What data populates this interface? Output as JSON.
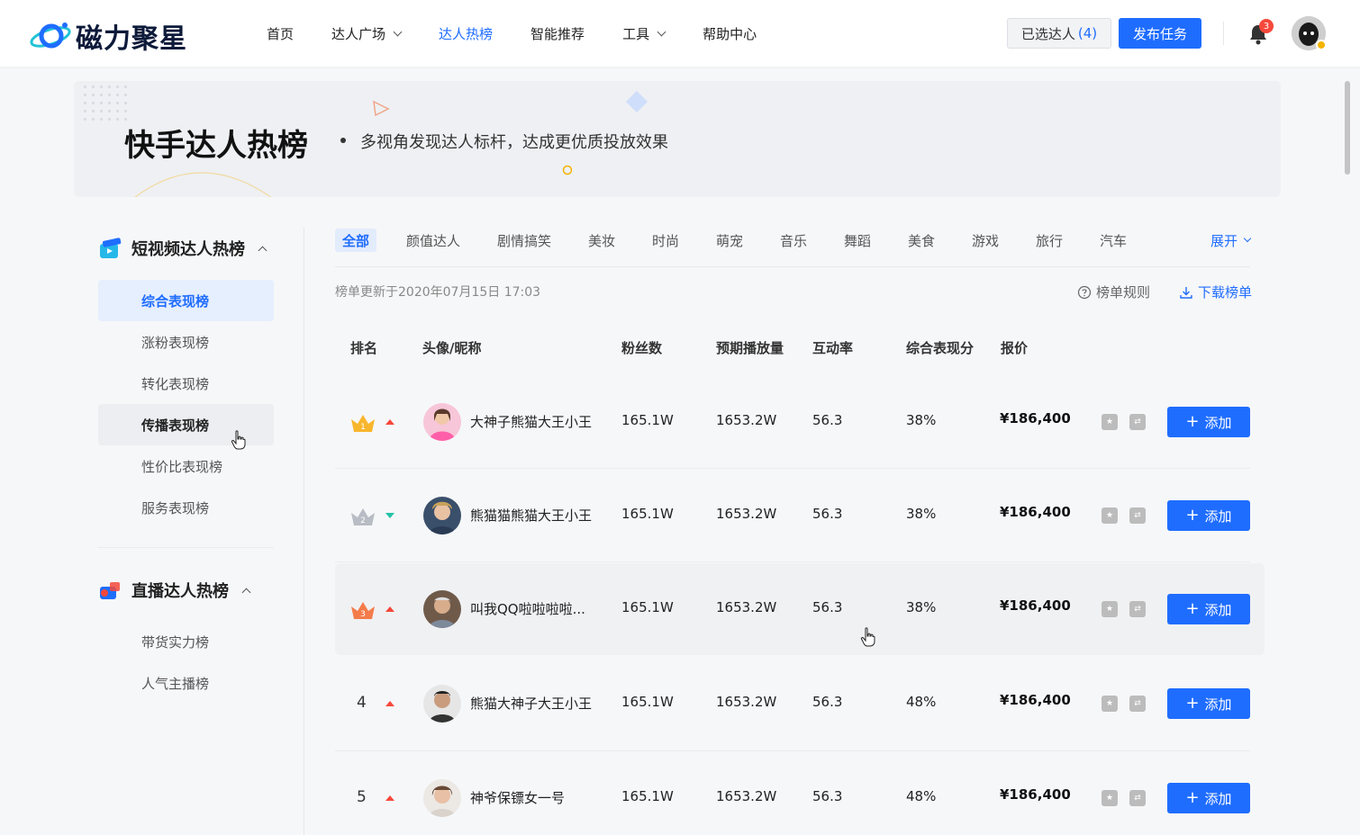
{
  "app": {
    "logo_text": "磁力聚星",
    "colors": {
      "brand": "#1f6dff",
      "accent_red": "#f5483b",
      "accent_teal": "#23c2a5",
      "highlight_bg": "#e6effd"
    }
  },
  "nav": {
    "items": [
      {
        "label": "首页",
        "active": false,
        "dropdown": false
      },
      {
        "label": "达人广场",
        "active": false,
        "dropdown": true
      },
      {
        "label": "达人热榜",
        "active": true,
        "dropdown": false
      },
      {
        "label": "智能推荐",
        "active": false,
        "dropdown": false
      },
      {
        "label": "工具",
        "active": false,
        "dropdown": true
      },
      {
        "label": "帮助中心",
        "active": false,
        "dropdown": false
      }
    ],
    "selected_label": "已选达人",
    "selected_count": "(4)",
    "publish_label": "发布任务",
    "notification_count": "3"
  },
  "banner": {
    "title": "快手达人热榜",
    "subtitle": "多视角发现达人标杆，达成更优质投放效果"
  },
  "sidebar": {
    "group1": {
      "label": "短视频达人热榜",
      "items": [
        {
          "label": "综合表现榜",
          "state": "active"
        },
        {
          "label": "涨粉表现榜",
          "state": ""
        },
        {
          "label": "转化表现榜",
          "state": ""
        },
        {
          "label": "传播表现榜",
          "state": "hover"
        },
        {
          "label": "性价比表现榜",
          "state": ""
        },
        {
          "label": "服务表现榜",
          "state": ""
        }
      ]
    },
    "group2": {
      "label": "直播达人热榜",
      "items": [
        {
          "label": "带货实力榜",
          "state": ""
        },
        {
          "label": "人气主播榜",
          "state": ""
        }
      ]
    }
  },
  "tabs": {
    "items": [
      "全部",
      "颜值达人",
      "剧情搞笑",
      "美妆",
      "时尚",
      "萌宠",
      "音乐",
      "舞蹈",
      "美食",
      "游戏",
      "旅行",
      "汽车"
    ],
    "active_index": 0,
    "expand_label": "展开"
  },
  "meta": {
    "update_text": "榜单更新于2020年07月15日 17:03",
    "rules_label": "榜单规则",
    "download_label": "下载榜单"
  },
  "table": {
    "headers": {
      "rank": "排名",
      "profile": "头像/昵称",
      "fans": "粉丝数",
      "plays": "预期播放量",
      "interaction": "互动率",
      "score": "综合表现分",
      "price": "报价"
    },
    "add_label": "添加",
    "rows": [
      {
        "rank": "1",
        "trend": "up",
        "nickname": "大神子熊猫大王小王",
        "fans": "165.1W",
        "plays": "1653.2W",
        "interaction": "56.3",
        "score": "38%",
        "price": "¥186,400",
        "highlight": false
      },
      {
        "rank": "2",
        "trend": "down",
        "nickname": "熊猫猫熊猫大王小王",
        "fans": "165.1W",
        "plays": "1653.2W",
        "interaction": "56.3",
        "score": "38%",
        "price": "¥186,400",
        "highlight": false
      },
      {
        "rank": "3",
        "trend": "up",
        "nickname": "叫我QQ啦啦啦啦...",
        "fans": "165.1W",
        "plays": "1653.2W",
        "interaction": "56.3",
        "score": "38%",
        "price": "¥186,400",
        "highlight": true
      },
      {
        "rank": "4",
        "trend": "up",
        "nickname": "熊猫大神子大王小王",
        "fans": "165.1W",
        "plays": "1653.2W",
        "interaction": "56.3",
        "score": "48%",
        "price": "¥186,400",
        "highlight": false
      },
      {
        "rank": "5",
        "trend": "up",
        "nickname": "神爷保镖女一号",
        "fans": "165.1W",
        "plays": "1653.2W",
        "interaction": "56.3",
        "score": "48%",
        "price": "¥186,400",
        "highlight": false
      }
    ]
  }
}
